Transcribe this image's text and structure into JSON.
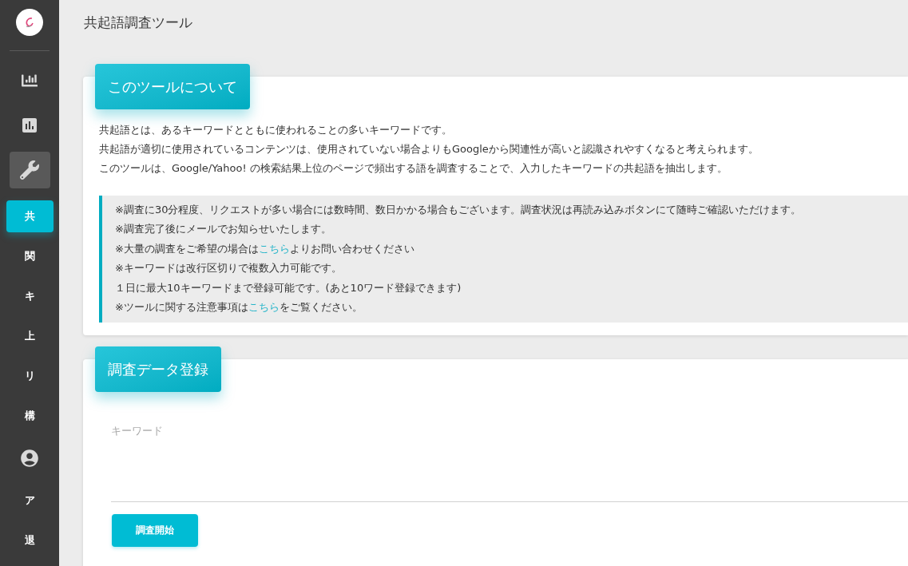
{
  "sidebar": {
    "items": [
      {
        "kind": "bar-chart",
        "selected": false
      },
      {
        "kind": "chart-square",
        "selected": false
      },
      {
        "kind": "wrench",
        "selected": true
      },
      {
        "kind": "text",
        "label": "共",
        "selected": true
      },
      {
        "kind": "text",
        "label": "関",
        "selected": false
      },
      {
        "kind": "text",
        "label": "キ",
        "selected": false
      },
      {
        "kind": "text",
        "label": "上",
        "selected": false
      },
      {
        "kind": "text",
        "label": "リ",
        "selected": false
      },
      {
        "kind": "text",
        "label": "構",
        "selected": false
      },
      {
        "kind": "account",
        "selected": false
      },
      {
        "kind": "text",
        "label": "ア",
        "selected": false
      },
      {
        "kind": "text",
        "label": "退",
        "selected": false
      }
    ]
  },
  "page_title": "共起語調査ツール",
  "about": {
    "heading": "このツールについて",
    "paragraphs": [
      "共起語とは、あるキーワードとともに使われることの多いキーワードです。",
      "共起語が適切に使用されているコンテンツは、使用されていない場合よりもGoogleから関連性が高いと認識されやすくなると考えられます。",
      "このツールは、Google/Yahoo! の検索結果上位のページで頻出する語を調査することで、入力したキーワードの共起語を抽出します。"
    ],
    "notes": [
      [
        {
          "kind": "text",
          "text": "※調査に30分程度、リクエストが多い場合には数時間、数日かかる場合もございます。調査状況は再読み込みボタンにて随時ご確認いただけます。"
        }
      ],
      [
        {
          "kind": "text",
          "text": "※調査完了後にメールでお知らせいたします。"
        }
      ],
      [
        {
          "kind": "text",
          "text": "※大量の調査をご希望の場合は"
        },
        {
          "kind": "link",
          "text": "こちら"
        },
        {
          "kind": "text",
          "text": "よりお問い合わせください"
        }
      ],
      [
        {
          "kind": "text",
          "text": "※キーワードは改行区切りで複数入力可能です。"
        }
      ],
      [
        {
          "kind": "text",
          "text": "１日に最大10キーワードまで登録可能です。(あと10ワード登録できます)"
        }
      ],
      [
        {
          "kind": "text",
          "text": "※ツールに関する注意事項は"
        },
        {
          "kind": "link",
          "text": "こちら"
        },
        {
          "kind": "text",
          "text": "をご覧ください。"
        }
      ]
    ]
  },
  "register": {
    "heading": "調査データ登録",
    "keyword_field": {
      "placeholder": "キーワード"
    },
    "submit_button": "調査開始"
  }
}
